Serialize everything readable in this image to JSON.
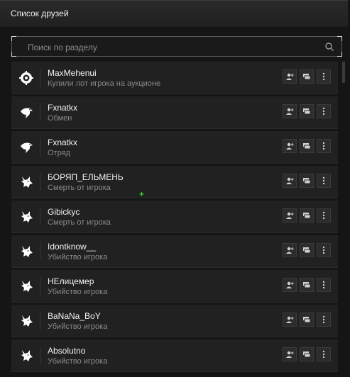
{
  "header": {
    "title": "Список друзей"
  },
  "search": {
    "placeholder": "Поиск по разделу",
    "icon": "search-icon"
  },
  "friends": [
    {
      "name": "MaxMehenui",
      "status": "Купили лот игрока на аукционе",
      "avatar": "gear-emblem-icon"
    },
    {
      "name": "Fxnatkx",
      "status": "Обмен",
      "avatar": "eagle-emblem-icon"
    },
    {
      "name": "Fxnatkx",
      "status": "Отряд",
      "avatar": "eagle-emblem-icon"
    },
    {
      "name": "БОРЯП_ЕЛЬМЕНЬ",
      "status": "Смерть от игрока",
      "avatar": "wolf-emblem-icon"
    },
    {
      "name": "Gibickyc",
      "status": "Смерть от игрока",
      "avatar": "wolf-emblem-icon"
    },
    {
      "name": "Idontknow__",
      "status": "Убийство игрока",
      "avatar": "wolf-emblem-icon"
    },
    {
      "name": "НЕлицемер",
      "status": "Убийство игрока",
      "avatar": "wolf-emblem-icon"
    },
    {
      "name": "BaNaNa_BoY",
      "status": "Убийство игрока",
      "avatar": "wolf-emblem-icon"
    },
    {
      "name": "Absolutno",
      "status": "Убийство игрока",
      "avatar": "wolf-emblem-icon"
    }
  ],
  "row_actions": [
    "add-friend-icon",
    "message-icon",
    "more-icon"
  ],
  "colors": {
    "background": "#151515",
    "row": "#212121",
    "cursor": "#2fd12f"
  }
}
